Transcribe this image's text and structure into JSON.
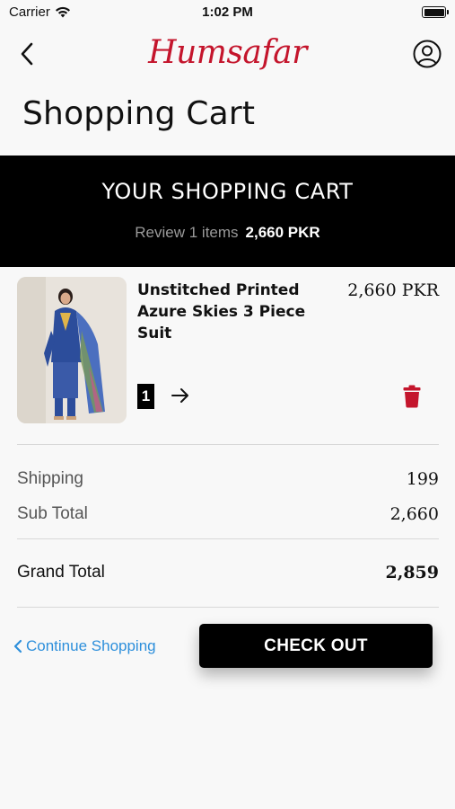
{
  "status_bar": {
    "carrier": "Carrier",
    "time": "1:02 PM"
  },
  "header": {
    "logo_text": "Humsafar",
    "brand_color": "#c4152c"
  },
  "page": {
    "title": "Shopping Cart"
  },
  "banner": {
    "heading": "YOUR SHOPPING CART",
    "review_text": "Review 1 items",
    "total": "2,660 PKR"
  },
  "cart": {
    "items": [
      {
        "name": "Unstitched Printed Azure Skies 3 Piece Suit",
        "price": "2,660 PKR",
        "quantity": "1"
      }
    ]
  },
  "summary": {
    "shipping_label": "Shipping",
    "shipping_value": "199",
    "subtotal_label": "Sub Total",
    "subtotal_value": "2,660",
    "grand_total_label": "Grand Total",
    "grand_total_value": "2,859"
  },
  "actions": {
    "continue_label": "Continue Shopping",
    "checkout_label": "CHECK OUT",
    "link_color": "#2d8fdb",
    "delete_color": "#c4152c"
  },
  "icons": [
    "wifi-icon",
    "battery-icon",
    "back-chevron-icon",
    "profile-icon",
    "arrow-right-icon",
    "trash-icon",
    "chevron-left-icon"
  ]
}
